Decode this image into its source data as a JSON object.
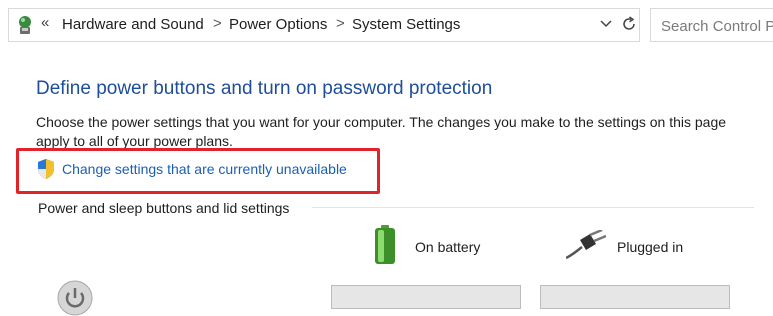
{
  "address_bar": {
    "overflow_chevron": "«",
    "breadcrumbs": [
      "Hardware and Sound",
      "Power Options",
      "System Settings"
    ],
    "separator": ">",
    "icons": [
      "control-panel-icon",
      "chevron-down-icon",
      "refresh-icon"
    ]
  },
  "search": {
    "placeholder": "Search Control Panel"
  },
  "main": {
    "title": "Define power buttons and turn on password protection",
    "description": "Choose the power settings that you want for your computer. The changes you make to the settings on this page apply to all of your power plans.",
    "admin_link": "Change settings that are currently unavailable",
    "section_label": "Power and sleep buttons and lid settings",
    "columns": [
      {
        "label": "On battery",
        "icon": "battery-icon"
      },
      {
        "label": "Plugged in",
        "icon": "power-plug-icon"
      }
    ]
  },
  "colors": {
    "title": "#1e4e9a",
    "link": "#1a5fb4",
    "highlight_border": "#e0242a"
  }
}
